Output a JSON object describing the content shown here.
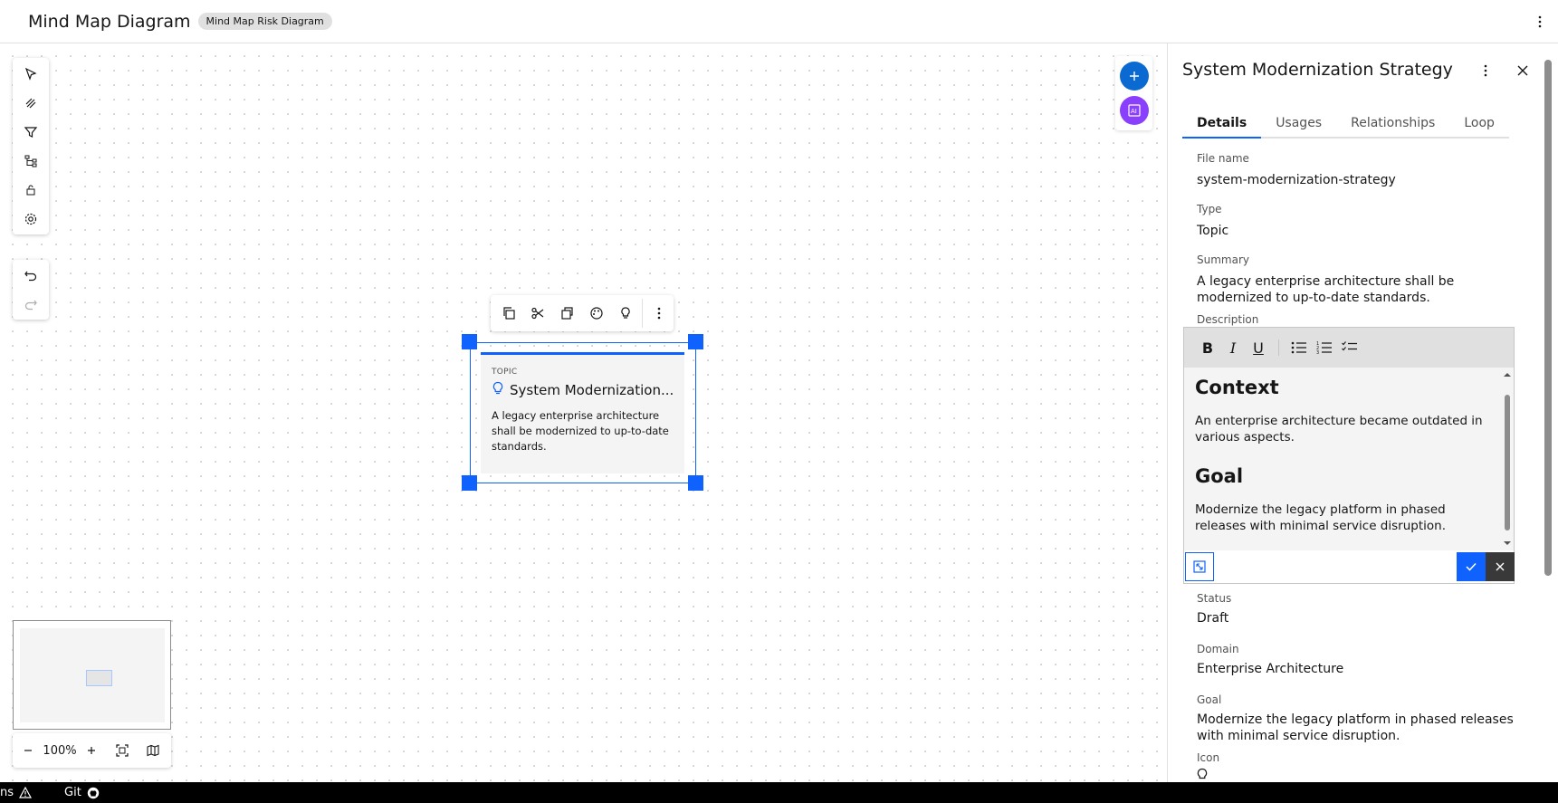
{
  "header": {
    "title": "Mind Map Diagram",
    "tag": "Mind Map Risk Diagram"
  },
  "canvas": {
    "zoom": "100%",
    "node": {
      "kind": "TOPIC",
      "title": "System Modernization...",
      "description": "A legacy enterprise architecture shall be modernized to up-to-date standards."
    }
  },
  "panel": {
    "title": "System Modernization Strategy",
    "tabs": [
      "Details",
      "Usages",
      "Relationships",
      "Loop"
    ],
    "fields": {
      "file_name_label": "File name",
      "file_name": "system-modernization-strategy",
      "type_label": "Type",
      "type": "Topic",
      "summary_label": "Summary",
      "summary": "A legacy enterprise architecture shall be modernized to up-to-date standards.",
      "description_label": "Description",
      "status_label": "Status",
      "status": "Draft",
      "domain_label": "Domain",
      "domain": "Enterprise Architecture",
      "goal_label": "Goal",
      "goal": "Modernize the legacy platform in phased releases with minimal service disruption.",
      "icon_label": "Icon"
    },
    "editor": {
      "h1": "Context",
      "p1": "An enterprise architecture became outdated in various aspects.",
      "h2": "Goal",
      "p2": "Modernize the legacy platform in phased releases with minimal service disruption."
    }
  },
  "statusbar": {
    "left": "ns",
    "git": "Git"
  },
  "colors": {
    "accent": "#0f62fe",
    "ai": "#8a3ffc",
    "fab": "#0b6ad2"
  }
}
